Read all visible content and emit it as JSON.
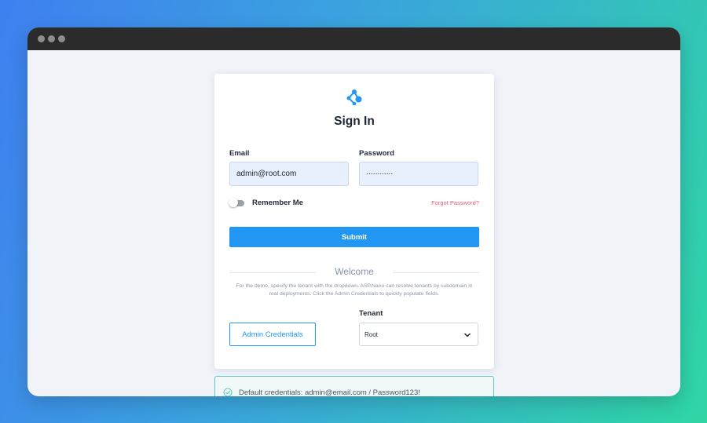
{
  "login": {
    "title": "Sign In",
    "email_label": "Email",
    "email_value": "admin@root.com",
    "password_label": "Password",
    "password_value": "············",
    "remember_label": "Remember Me",
    "forgot_label": "Forgot Password?",
    "submit_label": "Submit",
    "welcome_heading": "Welcome",
    "welcome_text": "For the demo, specify the tenant with the dropdown. ASP.Nano can resolve tenants by subdomain in real deployments. Click the Admin Credentials to quickly populate fields.",
    "admin_button_label": "Admin Credentials",
    "tenant_label": "Tenant",
    "tenant_selected": "Root"
  },
  "alert": {
    "message": "Default credentials: admin@email.com / Password123!"
  },
  "icons": {
    "logo": "network-nodes-icon",
    "dropdown": "chevron-down-icon",
    "alert": "check-circle-icon"
  },
  "colors": {
    "accent": "#2196f3",
    "link": "#f0587a",
    "alert_border": "#5fc9c0"
  }
}
